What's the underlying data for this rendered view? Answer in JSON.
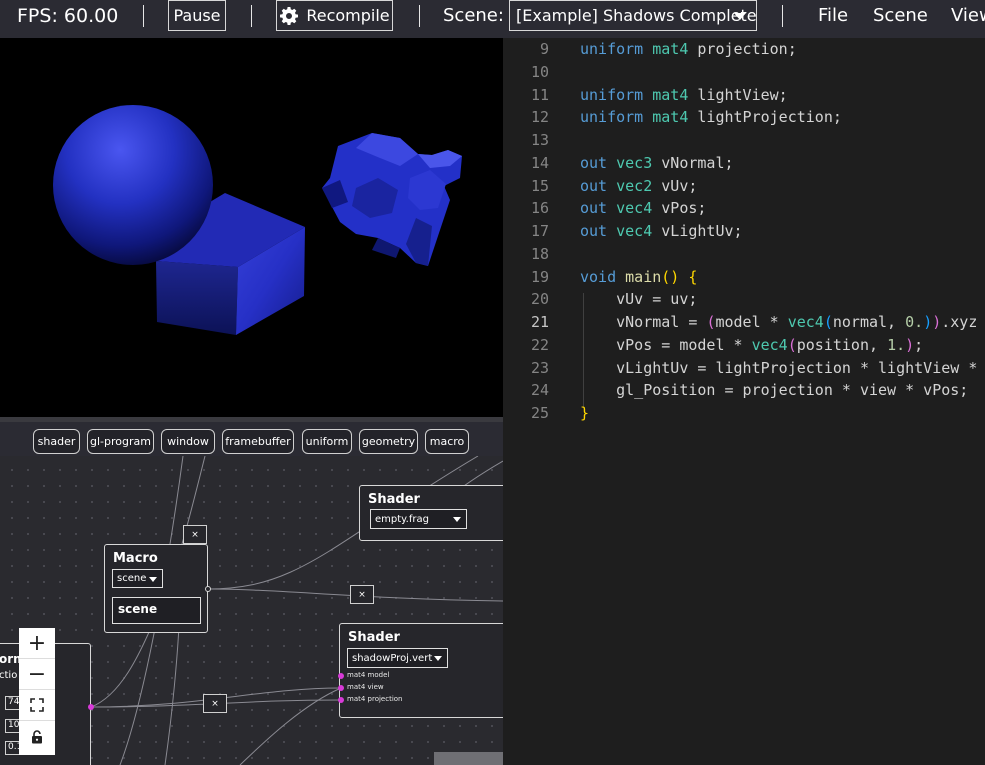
{
  "topbar": {
    "fps": "FPS: 60.00",
    "pause_label": "Pause",
    "recompile_label": "Recompile",
    "scene_label": "Scene:",
    "scene_value": "[Example] Shadows Complete",
    "menu": [
      "File",
      "Scene",
      "View"
    ]
  },
  "node_toolbar": [
    "shader",
    "gl-program",
    "window",
    "framebuffer",
    "uniform",
    "geometry",
    "macro"
  ],
  "graph": {
    "shader_top": {
      "title": "Shader",
      "file": "empty.frag"
    },
    "macro": {
      "title": "Macro",
      "select": "scene",
      "value": "scene"
    },
    "shader_bottom": {
      "title": "Shader",
      "file": "shadowProj.vert",
      "inputs": [
        "mat4 model",
        "mat4 view",
        "mat4 projection"
      ]
    },
    "partial_node": {
      "title": "orm",
      "subtitle": "ctio",
      "fields": [
        "74",
        "10",
        "0.1"
      ]
    },
    "remove_label": "×",
    "zoom": {
      "in": "+",
      "out": "−"
    }
  },
  "editor": {
    "active_line": 21,
    "lines": [
      {
        "n": "9",
        "t": [
          [
            "kw",
            "uniform"
          ],
          [
            "p",
            " "
          ],
          [
            "ty",
            "mat4"
          ],
          [
            "p",
            " projection;"
          ]
        ]
      },
      {
        "n": "10",
        "t": []
      },
      {
        "n": "11",
        "t": [
          [
            "kw",
            "uniform"
          ],
          [
            "p",
            " "
          ],
          [
            "ty",
            "mat4"
          ],
          [
            "p",
            " lightView;"
          ]
        ]
      },
      {
        "n": "12",
        "t": [
          [
            "kw",
            "uniform"
          ],
          [
            "p",
            " "
          ],
          [
            "ty",
            "mat4"
          ],
          [
            "p",
            " lightProjection;"
          ]
        ]
      },
      {
        "n": "13",
        "t": []
      },
      {
        "n": "14",
        "t": [
          [
            "kw",
            "out"
          ],
          [
            "p",
            " "
          ],
          [
            "ty",
            "vec3"
          ],
          [
            "p",
            " vNormal;"
          ]
        ]
      },
      {
        "n": "15",
        "t": [
          [
            "kw",
            "out"
          ],
          [
            "p",
            " "
          ],
          [
            "ty",
            "vec2"
          ],
          [
            "p",
            " vUv;"
          ]
        ]
      },
      {
        "n": "16",
        "t": [
          [
            "kw",
            "out"
          ],
          [
            "p",
            " "
          ],
          [
            "ty",
            "vec4"
          ],
          [
            "p",
            " vPos;"
          ]
        ]
      },
      {
        "n": "17",
        "t": [
          [
            "kw",
            "out"
          ],
          [
            "p",
            " "
          ],
          [
            "ty",
            "vec4"
          ],
          [
            "p",
            " vLightUv;"
          ]
        ]
      },
      {
        "n": "18",
        "t": []
      },
      {
        "n": "19",
        "t": [
          [
            "kw",
            "void"
          ],
          [
            "p",
            " "
          ],
          [
            "fn",
            "main"
          ],
          [
            "br1",
            "()"
          ],
          [
            "p",
            " "
          ],
          [
            "br1",
            "{"
          ]
        ]
      },
      {
        "n": "20",
        "t": [
          [
            "p",
            "    vUv = uv;"
          ]
        ]
      },
      {
        "n": "21",
        "t": [
          [
            "p",
            "    vNormal = "
          ],
          [
            "br2",
            "("
          ],
          [
            "p",
            "model * "
          ],
          [
            "ty",
            "vec4"
          ],
          [
            "br3",
            "("
          ],
          [
            "p",
            "normal, "
          ],
          [
            "nm",
            "0."
          ],
          [
            "br3",
            ")"
          ],
          [
            "br2",
            ")"
          ],
          [
            "p",
            ".xyz"
          ]
        ]
      },
      {
        "n": "22",
        "t": [
          [
            "p",
            "    vPos = model * "
          ],
          [
            "ty",
            "vec4"
          ],
          [
            "br2",
            "("
          ],
          [
            "p",
            "position, "
          ],
          [
            "nm",
            "1."
          ],
          [
            "br2",
            ")"
          ],
          [
            "p",
            ";"
          ]
        ]
      },
      {
        "n": "23",
        "t": [
          [
            "p",
            "    vLightUv = lightProjection * lightView *"
          ]
        ]
      },
      {
        "n": "24",
        "t": [
          [
            "p",
            "    gl_Position = projection * view * vPos;"
          ]
        ]
      },
      {
        "n": "25",
        "t": [
          [
            "br1",
            "}"
          ]
        ]
      }
    ]
  },
  "icons": {
    "recompile": "gear-icon",
    "fullscreen": "fullscreen-icon",
    "lock": "lock-icon"
  }
}
